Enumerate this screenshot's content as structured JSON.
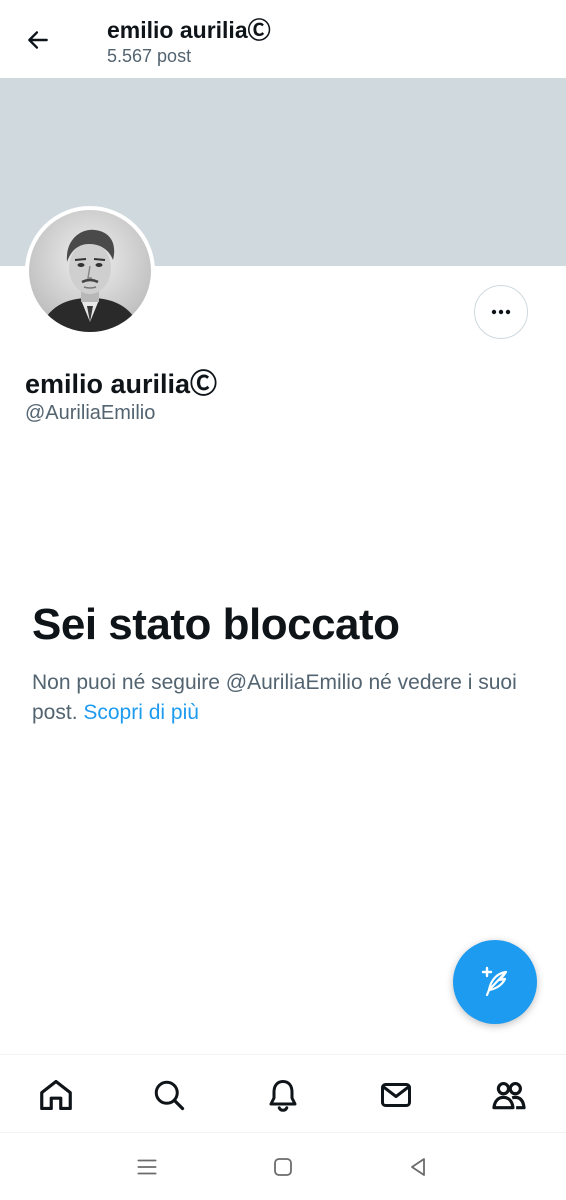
{
  "header": {
    "title": "emilio auriliaⒸ",
    "post_count": "5.567 post"
  },
  "profile": {
    "name": "emilio auriliaⒸ",
    "handle": "@AuriliaEmilio",
    "avatar": "portrait-photo"
  },
  "blocked": {
    "title": "Sei stato bloccato",
    "message": "Non puoi né seguire @AuriliaEmilio né vedere i suoi post.",
    "learn_more": "Scopri di più"
  },
  "bottom_nav": {
    "items": [
      "home-icon",
      "search-icon",
      "bell-icon",
      "mail-icon",
      "communities-icon"
    ]
  },
  "system_nav": {
    "items": [
      "recents-icon",
      "home-square-icon",
      "back-triangle-icon"
    ]
  },
  "colors": {
    "accent": "#1d9bf0",
    "banner": "#cfd9de",
    "secondary_text": "#536471",
    "primary_text": "#0f1419"
  }
}
